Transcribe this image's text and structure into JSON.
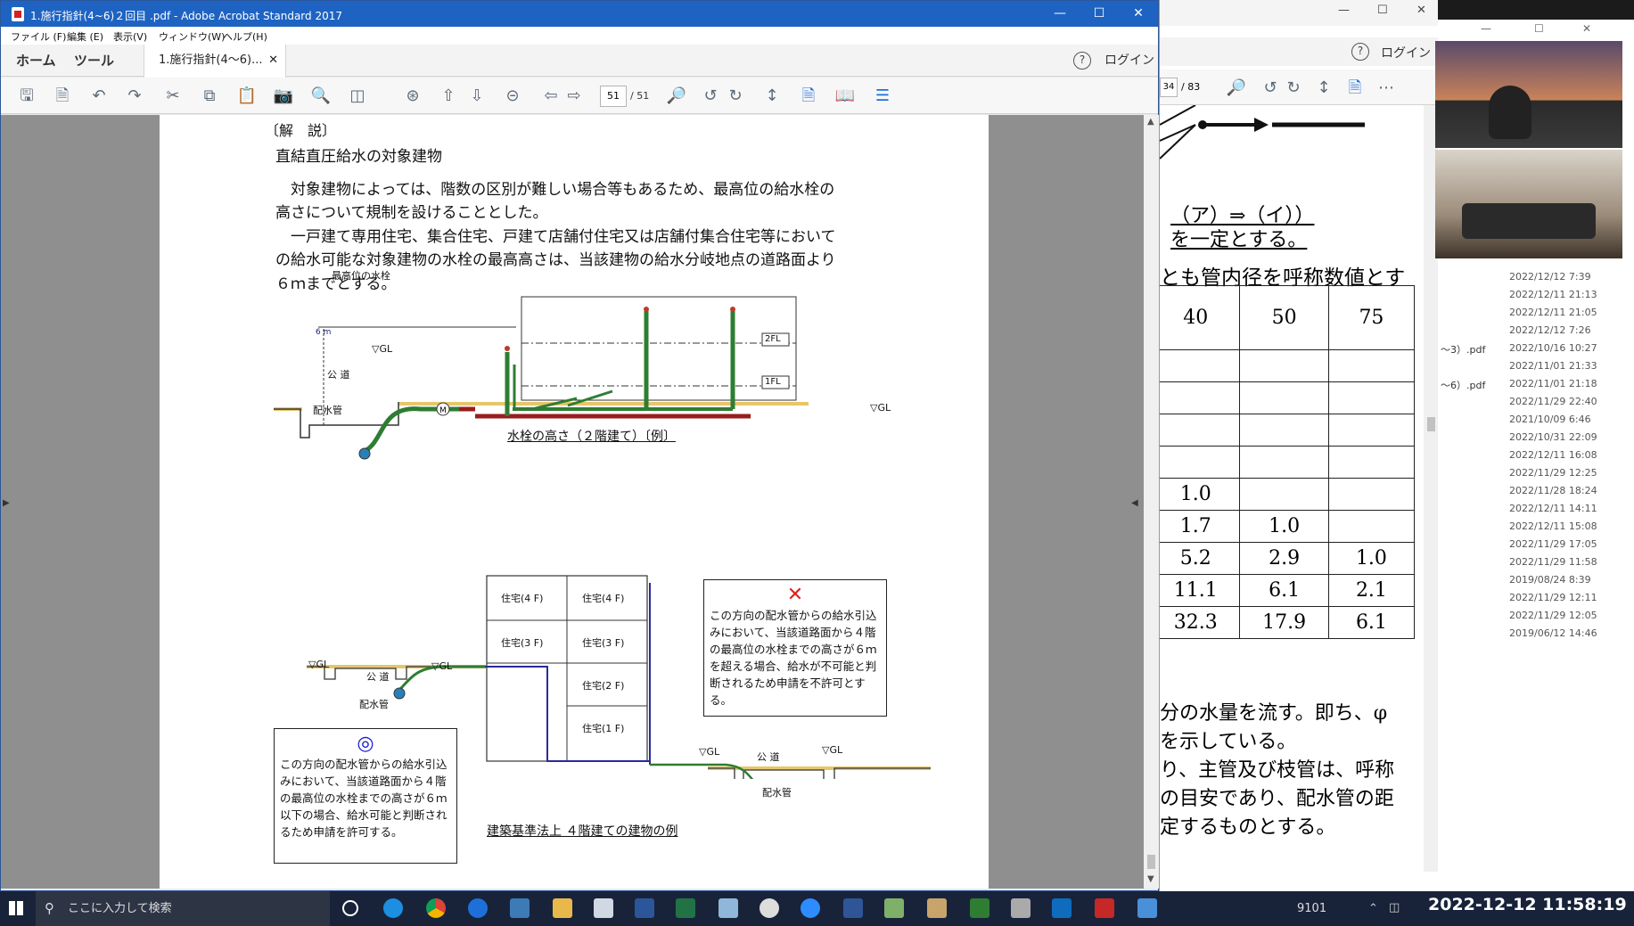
{
  "main_window": {
    "title": "1.施行指針(4~6)２回目 .pdf - Adobe Acrobat Standard 2017",
    "menu": [
      "ファイル (F)",
      "編集 (E)",
      "表示(V)",
      "ウィンドウ(W)",
      "ヘルプ(H)"
    ],
    "tabs": {
      "home": "ホーム",
      "tools": "ツール",
      "document": "1.施行指針(4～6)..."
    },
    "login": "ログイン",
    "page_current": "51",
    "page_total": "/ 51"
  },
  "document": {
    "heading_bracket": "〔解　説〕",
    "heading": "直結直圧給水の対象建物",
    "para1_line1": "　対象建物によっては、階数の区別が難しい場合等もあるため、最高位の給水栓の",
    "para1_line2": "高さについて規制を設けることとした。",
    "para2_line1": "　一戸建て専用住宅、集合住宅、戸建て店舗付住宅又は店舗付集合住宅等において",
    "para2_line2": "の給水可能な対象建物の水栓の最高高さは、当該建物の給水分岐地点の道路面より",
    "para2_line3": "６ｍまでとする。",
    "fig1": {
      "label_top": "最高位の水栓",
      "label_6m": "6 m",
      "label_gl": "▽GL",
      "label_road": "公 道",
      "label_main": "配水管",
      "label_2fl": "2FL",
      "label_1fl": "1FL",
      "label_gl2": "▽GL",
      "caption": "水栓の高さ（２階建て）〔例〕"
    },
    "fig2": {
      "units": [
        "住宅(4 F)",
        "住宅(4 F)",
        "住宅(3 F)",
        "住宅(3 F)",
        "住宅(2 F)",
        "住宅(1 F)"
      ],
      "left_gl1": "▽GL",
      "left_road": "公 道",
      "left_gl2": "▽GL",
      "left_main": "配水管",
      "right_gl1": "▽GL",
      "right_road": "公 道",
      "right_gl2": "▽GL",
      "right_main": "配水管",
      "ng_mark": "✕",
      "ng_text": "この方向の配水管からの給水引込みにおいて、当該道路面から４階の最高位の水栓までの高さが６ｍを超える場合、給水が不可能と判断されるため申請を不許可とする。",
      "ok_mark": "◎",
      "ok_text": "この方向の配水管からの給水引込みにおいて、当該道路面から４階の最高位の水栓までの高さが６ｍ以下の場合、給水可能と判断されるため申請を許可する。",
      "caption": "建築基準法上 ４階建ての建物の例"
    }
  },
  "right_window": {
    "login": "ログイン",
    "page_current": "34",
    "page_total": "/ 83",
    "lines": [
      "（ア）⇒（イ））",
      "を一定とする。",
      "とも管内径を呼称数値とす"
    ],
    "table": {
      "headers": [
        "40",
        "50",
        "75"
      ],
      "rows": [
        [
          "",
          "",
          ""
        ],
        [
          "",
          "",
          ""
        ],
        [
          "",
          "",
          ""
        ],
        [
          "",
          "",
          ""
        ],
        [
          "1.0",
          "",
          ""
        ],
        [
          "1.7",
          "1.0",
          ""
        ],
        [
          "5.2",
          "2.9",
          "1.0"
        ],
        [
          "11.1",
          "6.1",
          "2.1"
        ],
        [
          "32.3",
          "17.9",
          "6.1"
        ]
      ]
    },
    "bottom_lines": [
      "分の水量を流す。即ち、φ",
      "を示している。",
      "り、主管及び枝管は、呼称",
      "の目安であり、配水管の距",
      "定するものとする。"
    ]
  },
  "file_list": {
    "names": [
      "～3）.pdf",
      "～6）.pdf"
    ],
    "dates": [
      "2022/12/12 7:39",
      "2022/12/11 21:13",
      "2022/12/11 21:05",
      "2022/12/12 7:26",
      "2022/10/16 10:27",
      "2022/11/01 21:33",
      "2022/11/01 21:18",
      "2022/11/29 22:40",
      "2021/10/09 6:46",
      "2022/10/31 22:09",
      "2022/12/11 16:08",
      "2022/11/29 12:25",
      "2022/11/28 18:24",
      "2022/12/11 14:11",
      "2022/12/11 15:08",
      "2022/11/29 17:05",
      "2022/11/29 11:58",
      "2019/08/24 8:39",
      "2022/11/29 12:11",
      "2022/11/29 12:05",
      "2019/06/12 14:46"
    ]
  },
  "taskbar": {
    "search_placeholder": "ここに入力して検索",
    "stock": "9101",
    "datetime": "2022-12-12  11:58:19"
  },
  "colors": {
    "titlebar": "#1e63c2",
    "pipe_green": "#2e7d32",
    "pipe_red": "#9b1c1c",
    "pipe_blue": "#2a2a9e",
    "ground": "#e6c66a"
  }
}
